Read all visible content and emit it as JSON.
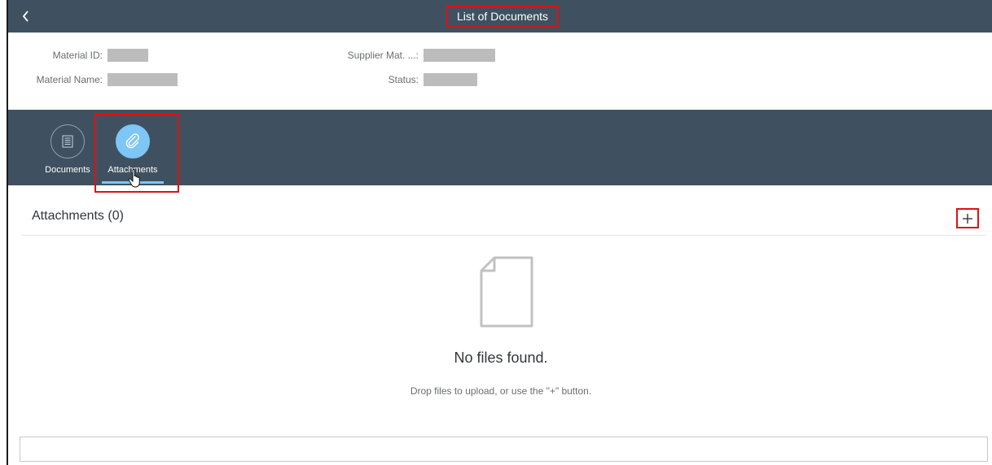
{
  "shell": {
    "title": "List of Documents",
    "back_icon": "chevron-left-icon"
  },
  "header": {
    "material_id_label": "Material ID:",
    "material_name_label": "Material Name:",
    "supplier_mat_label": "Supplier Mat. ...:",
    "status_label": "Status:"
  },
  "tabs": [
    {
      "label": "Documents",
      "icon": "list-icon",
      "selected": false
    },
    {
      "label": "Attachments",
      "icon": "paperclip-icon",
      "selected": true
    }
  ],
  "attachments": {
    "title": "Attachments (0)",
    "add_icon": "add-icon",
    "empty_title": "No files found.",
    "empty_description": "Drop files to upload, or use the \"+\" button."
  },
  "colors": {
    "shell_bg": "#3f5161",
    "selected_tab": "#7dc6f5",
    "highlight": "#e01010"
  }
}
